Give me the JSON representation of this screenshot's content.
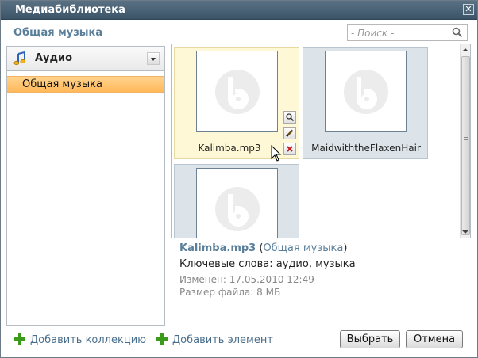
{
  "window": {
    "title": "Медиабиблиотека"
  },
  "header": {
    "breadcrumb": "Общая музыка"
  },
  "search": {
    "placeholder": "- Поиск -"
  },
  "sidebar": {
    "type_select_value": "Аудио",
    "collections": [
      {
        "label": "Общая музыка",
        "selected": true
      }
    ]
  },
  "items": [
    {
      "name": "Kalimba.mp3",
      "selected": true
    },
    {
      "name": "MaidwiththeFlaxenHair",
      "selected": false
    },
    {
      "name": "",
      "selected": false
    }
  ],
  "details": {
    "filename": "Kalimba.mp3",
    "paren_open": "(",
    "collection": "Общая музыка",
    "paren_close": ")",
    "keywords_label": "Ключевые слова:",
    "keywords": "аудио, музыка",
    "modified_label": "Изменен:",
    "modified": "17.05.2010 12:49",
    "size_label": "Размер файла:",
    "size": "8 МБ"
  },
  "footer": {
    "add_collection": "Добавить коллекцию",
    "add_item": "Добавить элемент",
    "select_button": "Выбрать",
    "cancel_button": "Отмена"
  },
  "colors": {
    "titlebar": "#4a6276",
    "selection": "#ffc26e",
    "link": "#4a6f8c",
    "add_icon": "#3a9a1a"
  },
  "icons": {
    "close": "close-icon",
    "search": "search-icon",
    "type": "music-note-icon",
    "thumb": "bitrix-logo-icon",
    "zoom": "magnifier-icon",
    "edit": "pencil-icon",
    "delete": "delete-icon",
    "add": "plus-icon"
  }
}
